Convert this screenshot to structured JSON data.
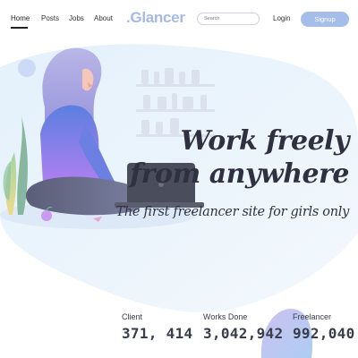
{
  "nav": {
    "links": [
      "Home",
      "Posts",
      "Jobs",
      "About"
    ],
    "logo": ".Glancer",
    "search_placeholder": "Search",
    "login": "Login",
    "signup": "Signup"
  },
  "hero": {
    "headline_line1": "Work freely",
    "headline_line2": "from anywhere",
    "tagline": "The first freelancer site for girls only"
  },
  "stats": [
    {
      "label": "Client",
      "value": "371, 414"
    },
    {
      "label": "Works Done",
      "value": "3,042,942"
    },
    {
      "label": "Freelancer",
      "value": "992,040"
    }
  ],
  "colors": {
    "accent": "#a4bde9",
    "logo": "#a7b8e6",
    "text": "#2f3140"
  }
}
